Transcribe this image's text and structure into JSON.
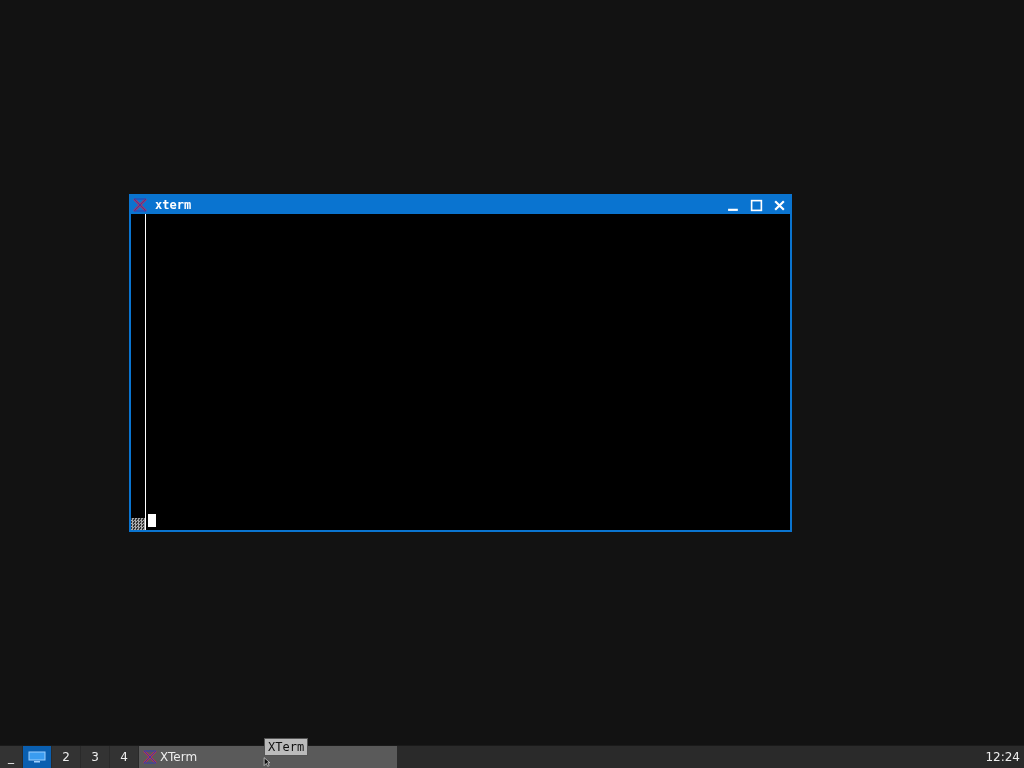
{
  "window": {
    "title": "xterm",
    "focused": true
  },
  "taskbar": {
    "show_desktop": "_",
    "workspaces": [
      {
        "kind": "icon",
        "selected": true
      },
      {
        "kind": "number",
        "label": "2",
        "selected": false
      },
      {
        "kind": "number",
        "label": "3",
        "selected": false
      },
      {
        "kind": "number",
        "label": "4",
        "selected": false
      }
    ],
    "tasks": [
      {
        "label": "XTerm",
        "selected": true
      }
    ],
    "clock": "12:24"
  },
  "tooltip": "XTerm"
}
